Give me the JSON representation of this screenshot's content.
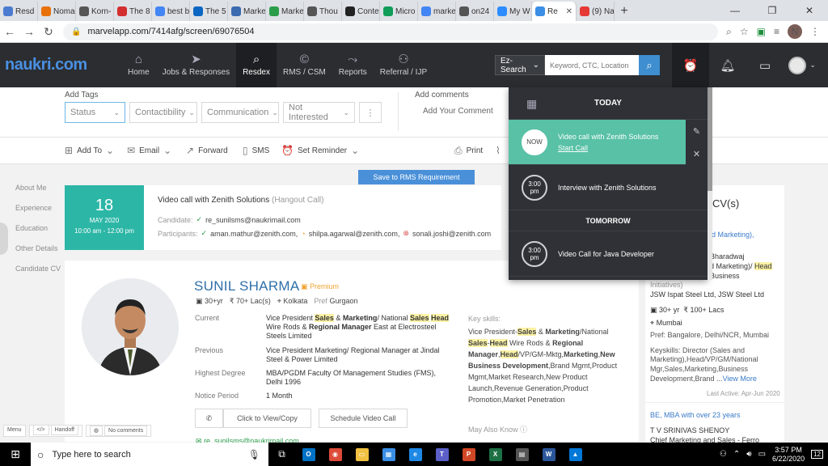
{
  "browser": {
    "tabs": [
      {
        "label": "Resd",
        "color": "#4a7bd0"
      },
      {
        "label": "Noma",
        "color": "#e8710a"
      },
      {
        "label": "Korn-",
        "color": "#555555"
      },
      {
        "label": "The 8",
        "color": "#d32f2f"
      },
      {
        "label": "best b",
        "color": "#4285f4"
      },
      {
        "label": "The 5",
        "color": "#0a66c2"
      },
      {
        "label": "Marke",
        "color": "#3a6bb0"
      },
      {
        "label": "Marke",
        "color": "#2a9d4a"
      },
      {
        "label": "Thou",
        "color": "#555555"
      },
      {
        "label": "Conte",
        "color": "#222222"
      },
      {
        "label": "Micro",
        "color": "#0f9d58"
      },
      {
        "label": "marke",
        "color": "#4285f4"
      },
      {
        "label": "on24",
        "color": "#555555"
      },
      {
        "label": "My W",
        "color": "#2d8cff"
      },
      {
        "label": "Re",
        "color": "#3a8ee6",
        "active": true
      },
      {
        "label": "(9) Na",
        "color": "#e53935"
      }
    ],
    "url": "marvelapp.com/7414afg/screen/69076504",
    "profile_initial": "N"
  },
  "header": {
    "logo": "naukri.com",
    "nav": [
      {
        "label": "Home",
        "icon": "home-icon",
        "glyph": "⌂"
      },
      {
        "label": "Jobs & Responses",
        "icon": "paper-plane-icon",
        "glyph": "➤"
      },
      {
        "label": "Resdex",
        "icon": "search-icon",
        "glyph": "⌕",
        "active": true
      },
      {
        "label": "RMS / CSM",
        "icon": "rms-icon",
        "glyph": "©"
      },
      {
        "label": "Reports",
        "icon": "chart-icon",
        "glyph": "⤳"
      },
      {
        "label": "Referral / IJP",
        "icon": "users-icon",
        "glyph": "⚇"
      }
    ],
    "ez_search": "Ez-Search",
    "search_placeholder": "Keyword, CTC, Location"
  },
  "tags": {
    "add_tags_label": "Add Tags",
    "status": "Status",
    "contactibility": "Contactibility",
    "communication": "Communication",
    "not_interested": "Not Interested",
    "more": "⋮",
    "add_comments_label": "Add comments",
    "comment_placeholder": "Add Your Comment"
  },
  "actions": {
    "add_to": "Add To",
    "email": "Email",
    "forward": "Forward",
    "sms": "SMS",
    "set_reminder": "Set Reminder",
    "print": "Print"
  },
  "leftnav": [
    "About Me",
    "Experience",
    "Education",
    "Other Details",
    "Candidate CV"
  ],
  "save_button": "Save to RMS Requirement",
  "event": {
    "day": "18",
    "month": "MAY 2020",
    "time": "10:00 am - 12:00 pm",
    "title": "Video call with Zenith Solutions",
    "type": "(Hangout Call)",
    "candidate_label": "Candidate:",
    "candidate": "re_sunilsms@naukrimail.com",
    "participants_label": "Participants:",
    "p1": "aman.mathur@zenith.com,",
    "p2": "shilpa.agarwal@zenith.com,",
    "p3": "sonali.joshi@zenith.com"
  },
  "profile": {
    "name": "SUNIL SHARMA",
    "premium": "Premium",
    "exp": "30+yr",
    "ctc": "₹ 70+ Lac(s)",
    "location": "Kolkata",
    "pref_label": "Pref",
    "pref": "Gurgaon",
    "current_label": "Current",
    "current_parts": [
      "Vice President ",
      "Sales",
      " & ",
      "Marketing",
      "/ National ",
      "Sales",
      " ",
      "Head",
      " Wire Rods & ",
      "Regional Manager",
      " East at Electrosteel Steels Limited"
    ],
    "previous_label": "Previous",
    "previous": "Vice President Marketing/ Regional Manager at Jindal Steel & Power Limited",
    "degree_label": "Highest Degree",
    "degree": "MBA/PGDM Faculty Of Management Studies (FMS), Delhi 1996",
    "notice_label": "Notice Period",
    "notice": "1 Month",
    "keyskills_label": "Key skills:",
    "keyskills_parts": [
      "Vice President-",
      "Sales",
      " & ",
      "Marketing",
      "/National ",
      "Sales",
      "-",
      "Head",
      " Wire Rods & ",
      "Regional Manager",
      ",",
      "Head",
      "/VP/GM-Mktg,",
      "Marketing",
      ",",
      "New Business Development",
      ",Brand Mgmt,Product Mgmt,Market Research,New Product Launch,Revenue Generation,Product Promotion,Market Penetration"
    ],
    "view_contact": "Click to View/Copy",
    "schedule": "Schedule Video Call",
    "may_also_know": "May Also Know",
    "email_partial": "re_sunilsms@naukrimail.com"
  },
  "rightpanel": {
    "heading": "r CV(s)",
    "l1": "d Marketing),",
    "l2": "Bharadwaj",
    "l3a": "d Marketing)/ ",
    "l3b": "Head",
    "l4": "Business",
    "l5": "Initiatives)",
    "company": "JSW Ispat Steel Ltd, JSW Steel Ltd",
    "exp": "30+ yr",
    "ctc": "100+ Lacs",
    "location": "Mumbai",
    "pref": "Pref: Bangalore, Delhi/NCR, Mumbai",
    "ks1": "Keyskills: Director (Sales and",
    "ks2": "Marketing),Head/VP/GM/National",
    "ks3": "Mgr,Sales,Marketing,Business",
    "ks4": "Development,Brand ...",
    "view_more": "View More",
    "last_active": "Last Active: Apr-Jun 2020",
    "edu": "BE, MBA with over 23 years",
    "name2": "T V SRINIVAS SHENOY",
    "title2": "Chief Marketing and Sales - Ferro"
  },
  "notifications": {
    "today": "TODAY",
    "items": [
      {
        "badge": "NOW",
        "title": "Video call with Zenith Solutions",
        "link": "Start Call"
      },
      {
        "badge": "3:00 pm",
        "title": "Interview with Zenith Solutions"
      }
    ],
    "tomorrow": "TOMORROW",
    "tomorrow_items": [
      {
        "badge": "3:00 pm",
        "title": "Video Call for Java Developer"
      }
    ]
  },
  "widget": {
    "menu": "Menu",
    "handoff": "Handoff",
    "comments": "No comments"
  },
  "taskbar": {
    "search_placeholder": "Type here to search",
    "time": "3:57 PM",
    "date": "6/22/2020",
    "notif_count": "12",
    "apps": [
      {
        "name": "outlook-icon",
        "color": "#0072c6",
        "glyph": "O"
      },
      {
        "name": "chrome-icon",
        "color": "#dd4b39",
        "glyph": "◉"
      },
      {
        "name": "file-explorer-icon",
        "color": "#f0c040",
        "glyph": "▭"
      },
      {
        "name": "store-icon",
        "color": "#3a8ee6",
        "glyph": "▦"
      },
      {
        "name": "edge-icon",
        "color": "#1e88e5",
        "glyph": "e"
      },
      {
        "name": "teams-icon",
        "color": "#5b5fc7",
        "glyph": "T"
      },
      {
        "name": "powerpoint-icon",
        "color": "#d24726",
        "glyph": "P"
      },
      {
        "name": "excel-icon",
        "color": "#1d7044",
        "glyph": "X"
      },
      {
        "name": "calculator-icon",
        "color": "#555555",
        "glyph": "▤"
      },
      {
        "name": "word-icon",
        "color": "#2b579a",
        "glyph": "W"
      },
      {
        "name": "photos-icon",
        "color": "#0078d7",
        "glyph": "▲"
      }
    ]
  }
}
